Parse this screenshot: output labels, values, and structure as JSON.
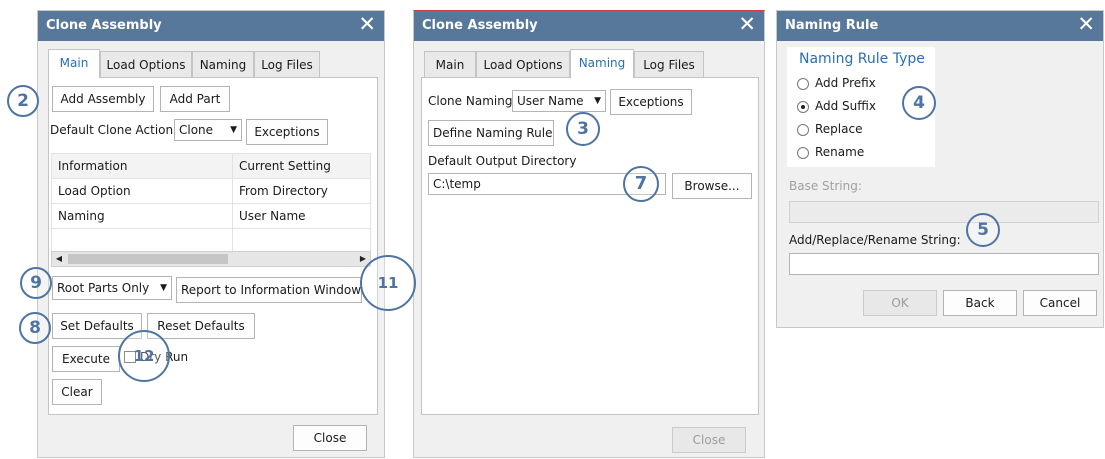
{
  "dialog1": {
    "title": "Clone Assembly",
    "tabs": [
      "Main",
      "Load Options",
      "Naming",
      "Log Files"
    ],
    "add_assembly": "Add Assembly",
    "add_part": "Add Part",
    "default_clone_action_label": "Default Clone Action",
    "clone_action_value": "Clone",
    "exceptions": "Exceptions",
    "table": {
      "headers": [
        "Information",
        "Current Setting"
      ],
      "rows": [
        [
          "Load Option",
          "From Directory"
        ],
        [
          "Naming",
          "User Name"
        ]
      ]
    },
    "root_parts_value": "Root Parts Only",
    "report_button": "Report to Information Window",
    "set_defaults": "Set Defaults",
    "reset_defaults": "Reset Defaults",
    "execute": "Execute",
    "dry_run": "Dry Run",
    "clear": "Clear",
    "close": "Close"
  },
  "dialog2": {
    "title": "Clone Assembly",
    "tabs": [
      "Main",
      "Load Options",
      "Naming",
      "Log Files"
    ],
    "clone_naming_label": "Clone Naming",
    "clone_naming_value": "User Name",
    "exceptions": "Exceptions",
    "define_naming_rule": "Define Naming Rule",
    "default_output_dir_label": "Default Output Directory",
    "output_dir_value": "C:\\temp",
    "browse": "Browse...",
    "close": "Close"
  },
  "dialog3": {
    "title": "Naming Rule",
    "group_title": "Naming Rule Type",
    "options": [
      "Add Prefix",
      "Add Suffix",
      "Replace",
      "Rename"
    ],
    "selected_option": "Add Suffix",
    "base_string_label": "Base String:",
    "replace_string_label": "Add/Replace/Rename String:",
    "ok": "OK",
    "back": "Back",
    "cancel": "Cancel"
  },
  "callouts": {
    "c2": "2",
    "c3": "3",
    "c4": "4",
    "c5": "5",
    "c7": "7",
    "c8": "8",
    "c9": "9",
    "c11": "11",
    "c12": "12"
  },
  "colors": {
    "titlebar": "#57789a",
    "callout": "#4d74a3",
    "active_tab": "#2a6fb0"
  },
  "icons": [
    "close-icon",
    "dropdown-arrow-icon",
    "scroll-left-icon",
    "scroll-right-icon"
  ]
}
